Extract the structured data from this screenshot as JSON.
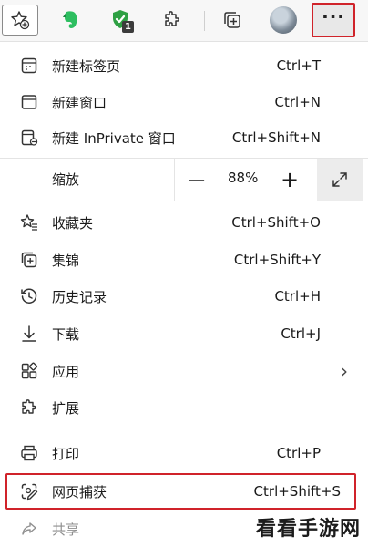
{
  "toolbar": {
    "badge_count": "1",
    "more_label": "···"
  },
  "menu": {
    "items": [
      {
        "label": "新建标签页",
        "shortcut": "Ctrl+T"
      },
      {
        "label": "新建窗口",
        "shortcut": "Ctrl+N"
      },
      {
        "label": "新建 InPrivate 窗口",
        "shortcut": "Ctrl+Shift+N"
      }
    ],
    "zoom": {
      "label": "缩放",
      "minus": "—",
      "value": "88%",
      "plus": "+"
    },
    "items2": [
      {
        "label": "收藏夹",
        "shortcut": "Ctrl+Shift+O"
      },
      {
        "label": "集锦",
        "shortcut": "Ctrl+Shift+Y"
      },
      {
        "label": "历史记录",
        "shortcut": "Ctrl+H"
      },
      {
        "label": "下载",
        "shortcut": "Ctrl+J"
      },
      {
        "label": "应用",
        "shortcut": ""
      },
      {
        "label": "扩展",
        "shortcut": ""
      }
    ],
    "items3": [
      {
        "label": "打印",
        "shortcut": "Ctrl+P"
      },
      {
        "label": "网页捕获",
        "shortcut": "Ctrl+Shift+S"
      },
      {
        "label": "共享",
        "shortcut": ""
      }
    ],
    "chevron": "›"
  },
  "watermark": "看看手游网",
  "colors": {
    "highlight": "#d0232a",
    "evernote": "#2dbe60",
    "shield": "#2ea043"
  }
}
